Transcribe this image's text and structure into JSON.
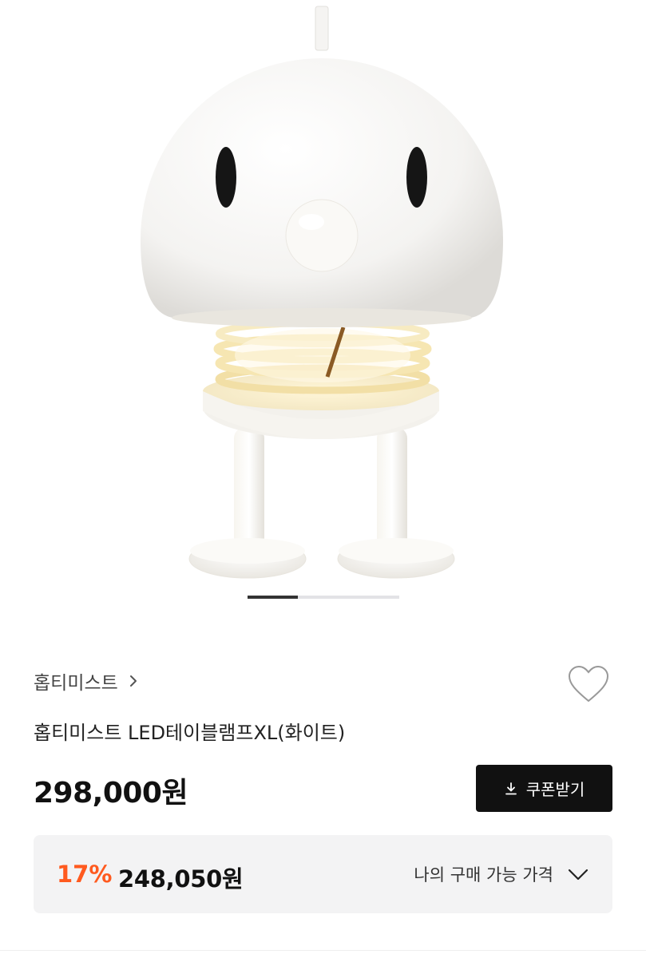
{
  "product": {
    "brand": "홉티미스트",
    "title": "홉티미스트 LED테이블램프XL(화이트)",
    "price": "298,000원",
    "image_alt": "hoptimist-led-table-lamp-white"
  },
  "gallery": {
    "active_index": 1,
    "count": 3
  },
  "coupon": {
    "label": "쿠폰받기",
    "icon": "download-icon"
  },
  "my_price": {
    "discount": "17%",
    "value": "248,050원",
    "label": "나의 구매 가능 가격",
    "icon": "chevron-down-icon"
  },
  "icons": {
    "brand_chevron": "chevron-right-icon",
    "wishlist": "heart-icon"
  },
  "colors": {
    "accent_discount": "#ff5a1f",
    "button_bg": "#111111",
    "panel_bg": "#f3f3f4"
  }
}
